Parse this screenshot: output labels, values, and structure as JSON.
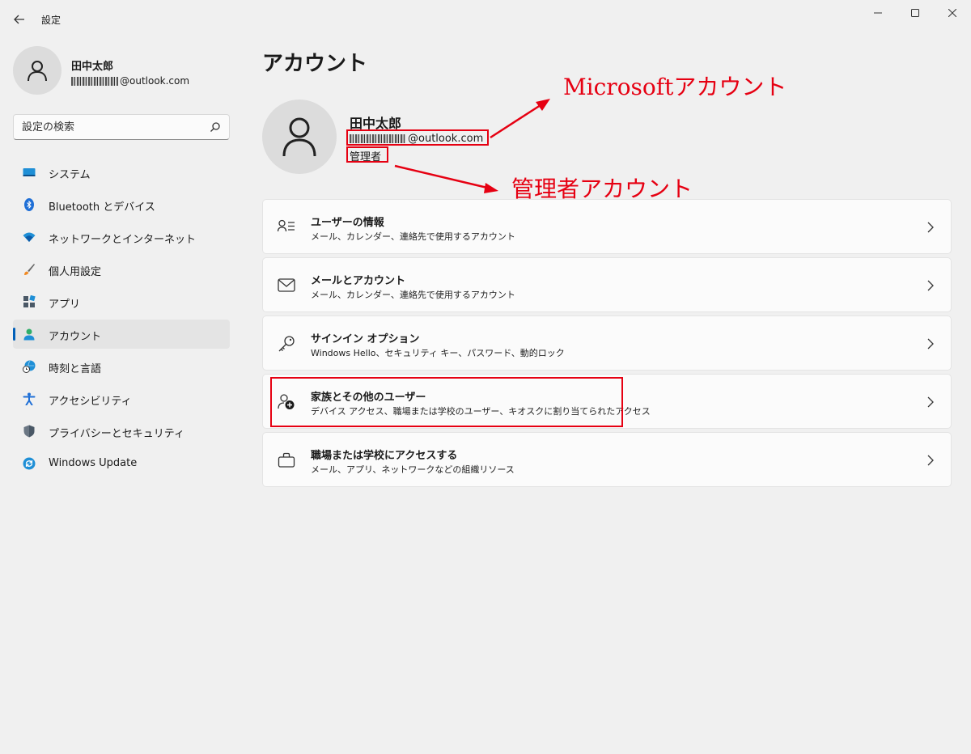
{
  "window": {
    "title": "設定",
    "controls": [
      "minimize-icon",
      "maximize-icon",
      "close-icon"
    ]
  },
  "profile": {
    "name": "田中太郎",
    "email_domain": "@outlook.com"
  },
  "search": {
    "placeholder": "設定の検索"
  },
  "nav": {
    "items": [
      {
        "label": "システム",
        "icon": "system-icon",
        "active": false
      },
      {
        "label": "Bluetooth とデバイス",
        "icon": "bluetooth-icon",
        "active": false
      },
      {
        "label": "ネットワークとインターネット",
        "icon": "wifi-icon",
        "active": false
      },
      {
        "label": "個人用設定",
        "icon": "brush-icon",
        "active": false
      },
      {
        "label": "アプリ",
        "icon": "apps-icon",
        "active": false
      },
      {
        "label": "アカウント",
        "icon": "account-icon",
        "active": true
      },
      {
        "label": "時刻と言語",
        "icon": "globe-clock-icon",
        "active": false
      },
      {
        "label": "アクセシビリティ",
        "icon": "accessibility-icon",
        "active": false
      },
      {
        "label": "プライバシーとセキュリティ",
        "icon": "shield-icon",
        "active": false
      },
      {
        "label": "Windows Update",
        "icon": "update-icon",
        "active": false
      }
    ]
  },
  "main": {
    "title": "アカウント",
    "account": {
      "name": "田中太郎",
      "email_domain": "@outlook.com",
      "role": "管理者"
    },
    "cards": [
      {
        "title": "ユーザーの情報",
        "subtitle": "メール、カレンダー、連絡先で使用するアカウント",
        "icon": "user-info-icon"
      },
      {
        "title": "メールとアカウント",
        "subtitle": "メール、カレンダー、連絡先で使用するアカウント",
        "icon": "mail-icon"
      },
      {
        "title": "サインイン オプション",
        "subtitle": "Windows Hello、セキュリティ キー、パスワード、動的ロック",
        "icon": "key-icon"
      },
      {
        "title": "家族とその他のユーザー",
        "subtitle": "デバイス アクセス、職場または学校のユーザー、キオスクに割り当てられたアクセス",
        "icon": "add-user-icon"
      },
      {
        "title": "職場または学校にアクセスする",
        "subtitle": "メール、アプリ、ネットワークなどの組織リソース",
        "icon": "briefcase-icon"
      }
    ]
  },
  "annotations": {
    "microsoft_account": "Microsoftアカウント",
    "admin_account": "管理者アカウント",
    "color": "#e60012"
  },
  "colors": {
    "accent": "#005fb8",
    "background": "#f0f0f0",
    "card": "#fbfbfb"
  }
}
